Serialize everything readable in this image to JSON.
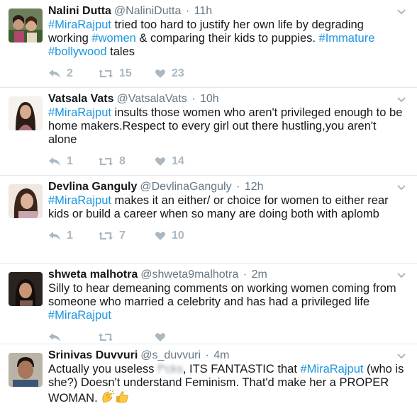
{
  "colors": {
    "link": "#1b95e0",
    "meta": "#657786",
    "icon": "#aab8c2",
    "divider": "#e1e8ed"
  },
  "icons": {
    "reply": "reply-icon",
    "retweet": "retweet-icon",
    "like": "heart-icon",
    "more": "chevron-down-icon"
  },
  "tweets": [
    {
      "name": "Nalini Dutta",
      "handle": "@NaliniDutta",
      "sep": "·",
      "time": "11h",
      "text": {
        "h1": "#MiraRajput",
        "t1": " tried too hard to justify her own life by degrading working ",
        "h2": "#women",
        "t2": " & comparing their kids to puppies. ",
        "h3": "#Immature",
        "t3": " ",
        "h4": "#bollywood",
        "t4": " tales"
      },
      "replies": "2",
      "retweets": "15",
      "likes": "23"
    },
    {
      "name": "Vatsala Vats",
      "handle": "@VatsalaVats",
      "sep": "·",
      "time": "10h",
      "text": {
        "h1": "#MiraRajput",
        "t1": " insults those women who aren't privileged enough to be home makers.Respect to every girl out there hustling,you aren't alone"
      },
      "replies": "1",
      "retweets": "8",
      "likes": "14"
    },
    {
      "name": "Devlina Ganguly",
      "handle": "@DevlinaGanguly",
      "sep": "·",
      "time": "12h",
      "text": {
        "h1": "#MiraRajput",
        "t1": " makes it an either/ or choice for women to either rear kids or build a career when so many are doing both with aplomb"
      },
      "replies": "1",
      "retweets": "7",
      "likes": "10"
    },
    {
      "name": "shweta malhotra",
      "handle": "@shweta9malhotra",
      "sep": "·",
      "time": "2m",
      "text": {
        "t1": "Silly to hear demeaning comments on working women coming from someone who married a celebrity and has had a privileged life ",
        "h1": "#MiraRajput"
      },
      "replies": "",
      "retweets": "",
      "likes": ""
    },
    {
      "name": "Srinivas Duvvuri",
      "handle": "@s_duvvuri",
      "sep": "·",
      "time": "4m",
      "text": {
        "t1": "Actually you useless ",
        "blurred": "f*cks",
        "t2": ", ITS FANTASTIC that ",
        "h1": "#MiraRajput",
        "t3": " (who is she?) Doesn't understand Feminism. That'd make her a PROPER WOMAN. "
      },
      "emojis": [
        "clapping-hands-emoji",
        "thumbs-up-emoji"
      ]
    }
  ]
}
